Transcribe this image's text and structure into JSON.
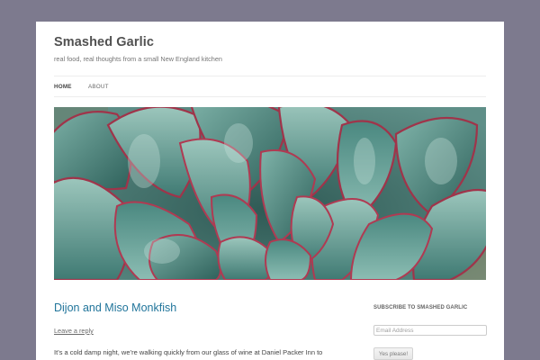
{
  "site": {
    "title": "Smashed Garlic",
    "tagline": "real food, real thoughts from a small New England kitchen"
  },
  "nav": {
    "items": [
      {
        "label": "HOME",
        "active": true
      },
      {
        "label": "ABOUT",
        "active": false
      }
    ]
  },
  "hero": {
    "image": "succulent-photo",
    "colors": {
      "leaf": "#4f8f87",
      "leaf_light": "#8fbdb2",
      "edge": "#a0344a",
      "background": "#3f6c66"
    }
  },
  "post": {
    "title": "Dijon and Miso Monkfish",
    "reply_label": "Leave a reply",
    "excerpt": "It’s a cold damp night, we’re walking quickly from our glass of wine at Daniel Packer Inn to"
  },
  "sidebar": {
    "widget_title": "SUBSCRIBE TO SMASHED GARLIC",
    "email_placeholder": "Email Address",
    "button_label": "Yes please!"
  },
  "colors": {
    "page_background": "#7d7a8e",
    "link": "#21759b"
  }
}
